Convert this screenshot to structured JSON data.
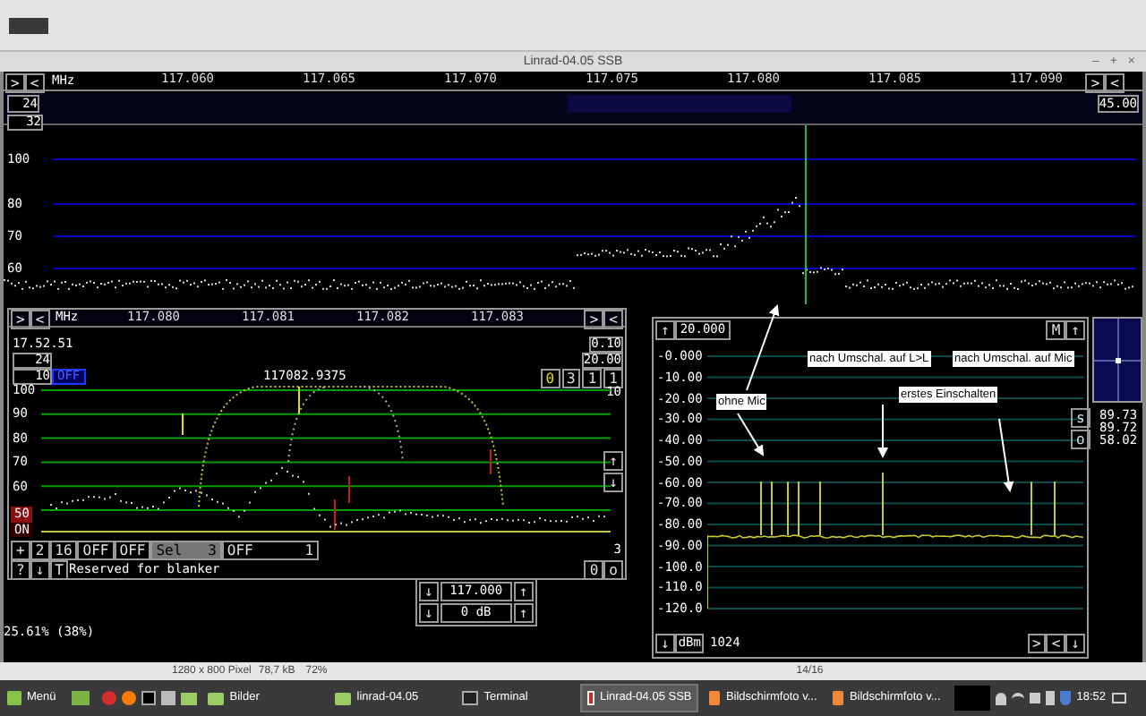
{
  "window": {
    "title": "Linrad-04.05 SSB",
    "controls": [
      "–",
      "+",
      "×"
    ]
  },
  "main_scale": {
    "left_buttons": [
      ">",
      "<"
    ],
    "unit": "MHz",
    "ticks": [
      "117.060",
      "117.065",
      "117.070",
      "117.075",
      "117.080",
      "117.085",
      "117.090"
    ],
    "right_buttons": [
      ">",
      "<"
    ]
  },
  "waterfall": {
    "left_value": "24",
    "right_value": "45.00",
    "lower_value": "32"
  },
  "main_spectrum": {
    "yticks": [
      "100",
      "80",
      "70",
      "60"
    ]
  },
  "baseband": {
    "scale_buttons": [
      ">",
      "<"
    ],
    "unit": "MHz",
    "ticks": [
      "117.080",
      "117.081",
      "117.082",
      "117.083"
    ],
    "scale_right_buttons": [
      ">",
      "<"
    ],
    "time": "17.52.51",
    "gain": "24",
    "right_values": [
      "0.10",
      "20.00"
    ],
    "bandwidth": "10",
    "mode": "OFF",
    "frequency": "117082.9375",
    "right_buttons": [
      "0",
      "3",
      "1",
      "1"
    ],
    "corner_value": "10",
    "yticks": [
      "100",
      "90",
      "80",
      "70",
      "60"
    ],
    "squelch_level": "50",
    "squelch_state": "ON",
    "scroll_buttons": [
      "↑",
      "↓"
    ],
    "bottom_buttons": [
      {
        "label": "+",
        "kind": "plain"
      },
      {
        "label": "2",
        "kind": "plain"
      },
      {
        "label": "16",
        "kind": "plain"
      },
      {
        "label": "OFF",
        "kind": "blue"
      },
      {
        "label": "OFF",
        "kind": "blue"
      },
      {
        "label": "Sel   3",
        "kind": "grey"
      },
      {
        "label": "OFF      1",
        "kind": "blue"
      }
    ],
    "side_value": "3",
    "blanker_buttons": [
      "?",
      "↓",
      "T"
    ],
    "blanker_text": "Reserved for blanker",
    "blanker_right_buttons": [
      "0",
      "o"
    ]
  },
  "frequency_controls": [
    {
      "down": "↓",
      "value": "117.000",
      "up": "↑"
    },
    {
      "down": "↓",
      "value": "0 dB",
      "up": "↑"
    }
  ],
  "load": "25.61% (38%)",
  "af_spectrum": {
    "top_button": "↑",
    "level": "20.000",
    "top_right_buttons": [
      "M",
      "↑"
    ],
    "yticks": [
      "-0.000",
      "-10.00",
      "-20.00",
      "-30.00",
      "-40.00",
      "-50.00",
      "-60.00",
      "-70.00",
      "-80.00",
      "-90.00",
      "-100.0",
      "-110.0",
      "-120.0"
    ],
    "bottom_left_button": "↓",
    "unit": "dBm",
    "fft_size": "1024",
    "bottom_right_buttons": [
      ">",
      "<",
      "↓"
    ]
  },
  "annotations": [
    "ohne Mic",
    "nach Umschal. auf L>L",
    "nach Umschal. auf Mic",
    "erstes Einschalten"
  ],
  "side_panel": {
    "readouts": [
      "89.73",
      "89.72",
      "58.02"
    ],
    "buttons": [
      "s",
      "o"
    ]
  },
  "image_viewer": {
    "info": "1280 x 800 Pixel",
    "size": "78,7 kB",
    "zoom": "72%",
    "page": "14/16"
  },
  "taskbar": {
    "menu": "Menü",
    "tasks": [
      {
        "label": "Bilder",
        "kind": "folder",
        "selected": false
      },
      {
        "label": "linrad-04.05",
        "kind": "folder",
        "selected": false
      },
      {
        "label": "Terminal",
        "kind": "terminal",
        "selected": false
      },
      {
        "label": "Linrad-04.05 SSB",
        "kind": "app",
        "selected": true
      },
      {
        "label": "Bildschirmfoto v...",
        "kind": "image",
        "selected": false
      },
      {
        "label": "Bildschirmfoto v...",
        "kind": "image",
        "selected": false
      }
    ],
    "clock": "18:52"
  }
}
